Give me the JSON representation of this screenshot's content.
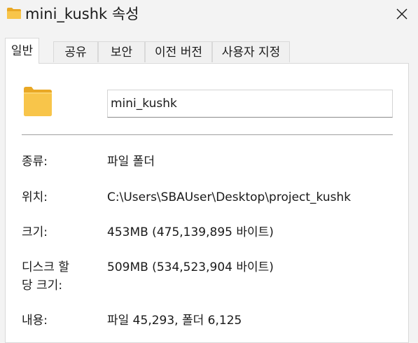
{
  "window": {
    "title": "mini_kushk 속성",
    "icon": "folder-icon",
    "accent": "#f8c54a"
  },
  "tabs": [
    {
      "label": "일반"
    },
    {
      "label": "공유"
    },
    {
      "label": "보안"
    },
    {
      "label": "이전 버전"
    },
    {
      "label": "사용자 지정"
    }
  ],
  "general": {
    "name_value": "mini_kushk",
    "rows": [
      {
        "label": "종류:",
        "value": "파일 폴더"
      },
      {
        "label": "위치:",
        "value": "C:\\Users\\SBAUser\\Desktop\\project_kushk"
      },
      {
        "label": "크기:",
        "value": "453MB (475,139,895 바이트)"
      },
      {
        "label": "디스크 할",
        "label2": "당 크기:",
        "value": "509MB (534,523,904 바이트)"
      },
      {
        "label": "내용:",
        "value": "파일 45,293, 폴더 6,125"
      }
    ]
  }
}
